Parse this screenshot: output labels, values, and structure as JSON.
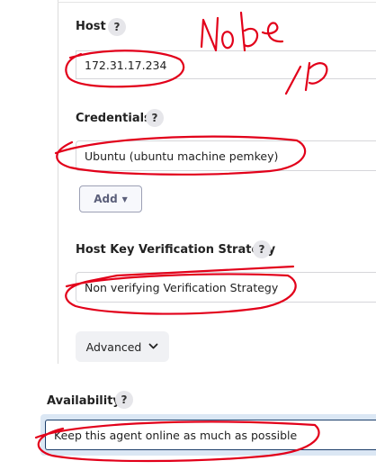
{
  "host": {
    "label": "Host",
    "help": "?",
    "value": "172.31.17.234"
  },
  "credentials": {
    "label": "Credentials",
    "help": "?",
    "value": "Ubuntu (ubuntu machine pemkey)",
    "add_label": "Add"
  },
  "host_key": {
    "label": "Host Key Verification Strategy",
    "help": "?",
    "value": "Non verifying Verification Strategy"
  },
  "advanced": {
    "label": "Advanced"
  },
  "availability": {
    "label": "Availability",
    "help": "?",
    "value": "Keep this agent online as much as possible"
  },
  "colors": {
    "annotation": "#e2001a",
    "accent_border": "#1d3f6b"
  },
  "icons": {
    "add_caret": "caret-down-icon",
    "advanced_chevron": "chevron-down-icon"
  }
}
